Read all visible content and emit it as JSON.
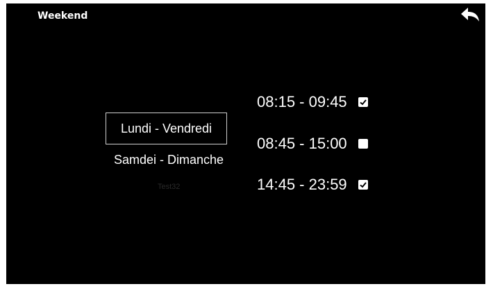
{
  "header": {
    "title": "Weekend",
    "back_icon": "back-arrow-icon"
  },
  "days": [
    {
      "label": "Lundi - Vendredi",
      "selected": true
    },
    {
      "label": "Samdei - Dimanche",
      "selected": false
    }
  ],
  "faint_label": "Test32",
  "time_slots": [
    {
      "time": "08:15 - 09:45",
      "checked": true
    },
    {
      "time": "08:45 - 15:00",
      "checked": false
    },
    {
      "time": "14:45 - 23:59",
      "checked": true
    }
  ],
  "colors": {
    "background": "#000000",
    "text": "#ffffff",
    "border": "#cfcfcf"
  }
}
